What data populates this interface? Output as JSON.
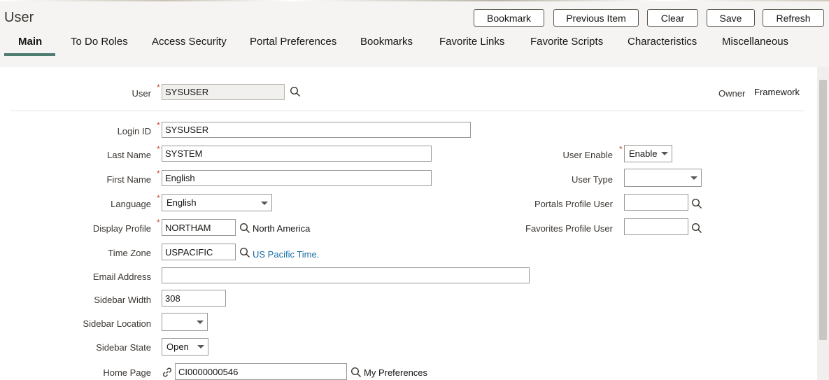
{
  "header": {
    "title": "User",
    "buttons": {
      "bookmark": "Bookmark",
      "previous_item": "Previous Item",
      "clear": "Clear",
      "save": "Save",
      "refresh": "Refresh"
    },
    "tabs": [
      "Main",
      "To Do Roles",
      "Access Security",
      "Portal Preferences",
      "Bookmarks",
      "Favorite Links",
      "Favorite Scripts",
      "Characteristics",
      "Miscellaneous"
    ],
    "active_tab": "Main"
  },
  "form": {
    "user": {
      "label": "User",
      "value": "SYSUSER"
    },
    "owner": {
      "label": "Owner",
      "value": "Framework"
    },
    "login_id": {
      "label": "Login ID",
      "value": "SYSUSER"
    },
    "last_name": {
      "label": "Last Name",
      "value": "SYSTEM"
    },
    "first_name": {
      "label": "First Name",
      "value": "English"
    },
    "language": {
      "label": "Language",
      "value": "English"
    },
    "display_profile": {
      "label": "Display Profile",
      "value": "NORTHAM",
      "description": "North America"
    },
    "time_zone": {
      "label": "Time Zone",
      "value": "USPACIFIC",
      "description": "US Pacific Time."
    },
    "email_address": {
      "label": "Email Address",
      "value": ""
    },
    "sidebar_width": {
      "label": "Sidebar Width",
      "value": "308"
    },
    "sidebar_location": {
      "label": "Sidebar Location",
      "value": ""
    },
    "sidebar_state": {
      "label": "Sidebar State",
      "value": "Open"
    },
    "home_page": {
      "label": "Home Page",
      "value": "CI0000000546",
      "description": "My Preferences"
    },
    "user_enable": {
      "label": "User Enable",
      "value": "Enable"
    },
    "user_type": {
      "label": "User Type",
      "value": ""
    },
    "portals_profile_user": {
      "label": "Portals Profile User",
      "value": ""
    },
    "favorites_profile_user": {
      "label": "Favorites Profile User",
      "value": ""
    }
  },
  "required_marker": "*",
  "colors": {
    "accent": "#4f7d72",
    "required": "#c74634",
    "link": "#1c6ea4",
    "header_bg": "#f5f4f2"
  },
  "icons": {
    "search": "search-icon",
    "link": "link-icon",
    "dropdown": "chevron-down-icon"
  }
}
